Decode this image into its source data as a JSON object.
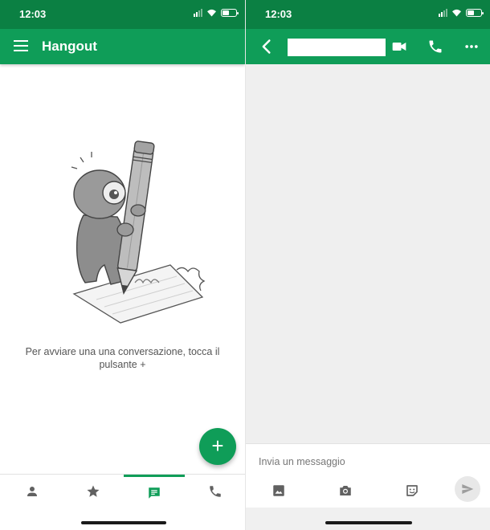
{
  "left": {
    "status": {
      "time": "12:03"
    },
    "app_bar": {
      "title": "Hangout",
      "menu_icon": "menu-icon"
    },
    "empty_state": {
      "illustration": "pencil-monster-illustration",
      "message": "Per avviare una una conversazione, tocca il pulsante +"
    },
    "fab": {
      "icon": "plus-icon",
      "label": "+"
    },
    "bottom_nav": {
      "items": [
        {
          "name": "contacts",
          "icon": "person-icon",
          "active": false
        },
        {
          "name": "favorites",
          "icon": "star-icon",
          "active": false
        },
        {
          "name": "conversations",
          "icon": "chat-icon",
          "active": true
        },
        {
          "name": "calls",
          "icon": "phone-icon",
          "active": false
        }
      ]
    }
  },
  "right": {
    "status": {
      "time": "12:03"
    },
    "app_bar": {
      "back_icon": "back-arrow-icon",
      "contact_name": "",
      "actions": [
        "video-call-icon",
        "phone-icon",
        "more-icon"
      ]
    },
    "composer": {
      "placeholder": "Invia un messaggio",
      "actions": [
        "image-icon",
        "camera-icon",
        "sticker-icon",
        "send-icon"
      ]
    }
  },
  "colors": {
    "status_bar": "#0b8043",
    "app_bar": "#0f9d58",
    "accent": "#0f9d58",
    "icon_gray": "#616161",
    "chat_background": "#efefef"
  }
}
